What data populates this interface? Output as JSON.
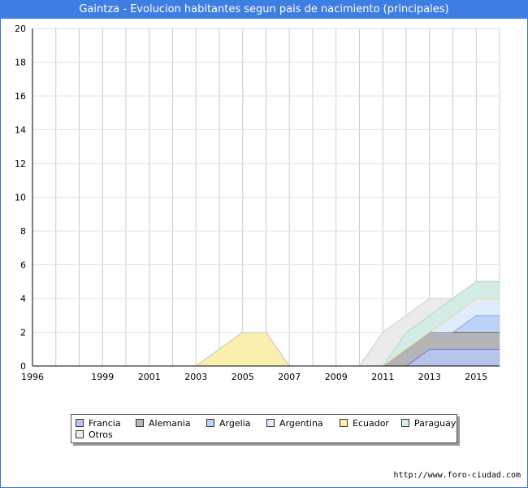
{
  "title": "Gaintza - Evolucion habitantes segun pais de nacimiento (principales)",
  "footer": "http://www.foro-ciudad.com",
  "chart_data": {
    "type": "area",
    "stacked": true,
    "x": [
      1996,
      1997,
      1998,
      1999,
      2000,
      2001,
      2002,
      2003,
      2004,
      2005,
      2006,
      2007,
      2008,
      2009,
      2010,
      2011,
      2012,
      2013,
      2014,
      2015,
      2016
    ],
    "xlim": [
      1996,
      2016
    ],
    "ylim": [
      0,
      20
    ],
    "x_ticks": [
      "1996",
      "1999",
      "2001",
      "2003",
      "2005",
      "2007",
      "2009",
      "2011",
      "2013",
      "2015"
    ],
    "y_ticks": [
      "0",
      "2",
      "4",
      "6",
      "8",
      "10",
      "12",
      "14",
      "16",
      "18",
      "20"
    ],
    "grid": true,
    "legend_position": "bottom",
    "series": [
      {
        "name": "Francia",
        "color": "#b7c4ee",
        "line": "#2b3fcf",
        "values": [
          0,
          0,
          0,
          0,
          0,
          0,
          0,
          0,
          0,
          0,
          0,
          0,
          0,
          0,
          0,
          0,
          0,
          1,
          1,
          1,
          1
        ]
      },
      {
        "name": "Alemania",
        "color": "#b4b4b4",
        "line": "#111111",
        "values": [
          0,
          0,
          0,
          0,
          0,
          0,
          0,
          0,
          0,
          0,
          0,
          0,
          0,
          0,
          0,
          0,
          1,
          1,
          1,
          1,
          1
        ]
      },
      {
        "name": "Argelia",
        "color": "#bcd2f6",
        "line": "#3a6fd8",
        "values": [
          0,
          0,
          0,
          0,
          0,
          0,
          0,
          0,
          0,
          0,
          0,
          0,
          0,
          0,
          0,
          0,
          0,
          0,
          0,
          1,
          1
        ]
      },
      {
        "name": "Argentina",
        "color": "#e0ecfb",
        "line": "#bcd4f4",
        "values": [
          0,
          0,
          0,
          0,
          0,
          0,
          0,
          0,
          0,
          0,
          0,
          0,
          0,
          0,
          0,
          0,
          0,
          0,
          1,
          1,
          1
        ]
      },
      {
        "name": "Ecuador",
        "color": "#fbefb0",
        "line": "#e7cd2e",
        "values": [
          0,
          0,
          0,
          0,
          0,
          0,
          0,
          0,
          1,
          2,
          2,
          0,
          0,
          0,
          0,
          0,
          0,
          0,
          0,
          0,
          0
        ]
      },
      {
        "name": "Paraguay",
        "color": "#d4ece8",
        "line": "#7fc2b8",
        "values": [
          0,
          0,
          0,
          0,
          0,
          0,
          0,
          0,
          0,
          0,
          0,
          0,
          0,
          0,
          0,
          0,
          1,
          1,
          1,
          1,
          1
        ]
      },
      {
        "name": "Otros",
        "color": "#ebebeb",
        "line": "#cfcfcf",
        "values": [
          0,
          0,
          0,
          0,
          0,
          0,
          0,
          0,
          0,
          0,
          0,
          0,
          0,
          0,
          0,
          2,
          1,
          1,
          0,
          0,
          0
        ]
      }
    ]
  }
}
